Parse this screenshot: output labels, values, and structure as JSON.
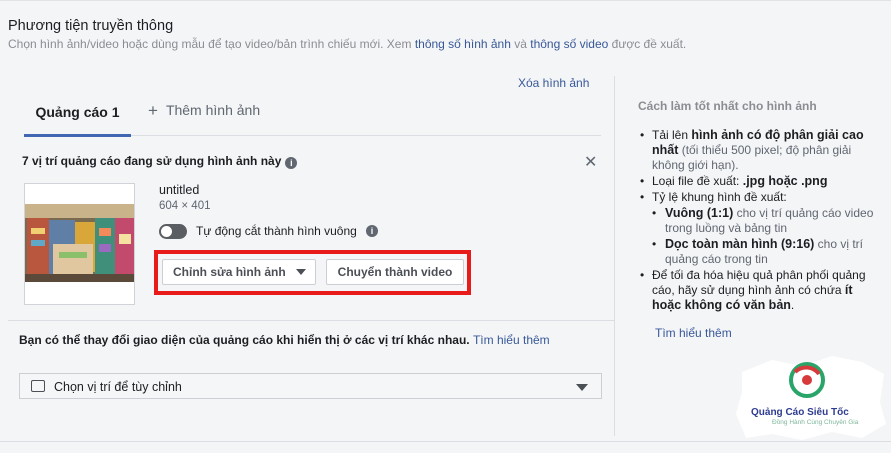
{
  "section": {
    "title": "Phương tiện truyền thông",
    "desc_prefix": "Chọn hình ảnh/video hoặc dùng mẫu để tạo video/bản trình chiếu mới. Xem ",
    "link1": "thông số hình ảnh",
    "desc_mid": " và ",
    "link2": "thông số video",
    "desc_suffix": " được đề xuất."
  },
  "remove_image": "Xóa hình ảnh",
  "tabs": [
    {
      "label": "Quảng cáo 1",
      "active": true
    },
    {
      "label": "Thêm hình ảnh",
      "active": false
    }
  ],
  "placements_note": "7 vị trí quảng cáo đang sử dụng hình ảnh này",
  "image": {
    "filename": "untitled",
    "dimensions": "604 × 401",
    "auto_crop_label": "Tự động cắt thành hình vuông",
    "auto_crop_on": false
  },
  "buttons": {
    "edit_image": "Chỉnh sửa hình ảnh",
    "to_video": "Chuyển thành video"
  },
  "change_note": {
    "text": "Bạn có thể thay đổi giao diện của quảng cáo khi hiển thị ở các vị trí khác nhau.",
    "link": "Tìm hiểu thêm"
  },
  "placement_select": "Chọn vị trí để tùy chỉnh",
  "best_practices": {
    "title": "Cách làm tốt nhất cho hình ảnh",
    "item1_pre": "Tải lên ",
    "item1_strong": "hình ảnh có độ phân giải cao nhất",
    "item1_post": " (tối thiểu 500 pixel; độ phân giải không giới hạn).",
    "item2_pre": "Loại file đề xuất: ",
    "item2_strong": ".jpg hoặc .png",
    "item3": "Tỷ lệ khung hình đề xuất:",
    "sub1_strong": "Vuông (1:1)",
    "sub1_post": " cho vị trí quảng cáo video trong luồng và bảng tin",
    "sub2_strong": "Dọc toàn màn hình (9:16)",
    "sub2_post": " cho vị trí quảng cáo trong tin",
    "item4_pre": "Để tối đa hóa hiệu quả phân phối quảng cáo, hãy sử dụng hình ảnh có chứa ",
    "item4_strong": "ít hoặc không có văn bản",
    "item4_post": ".",
    "link": "Tìm hiểu thêm"
  },
  "logo": {
    "name": "Quảng Cáo Siêu Tốc",
    "tagline": "Đồng Hành Cùng Chuyên Gia"
  },
  "colors": {
    "accent": "#4267b2",
    "link": "#385898",
    "highlight": "#e81a1a"
  }
}
